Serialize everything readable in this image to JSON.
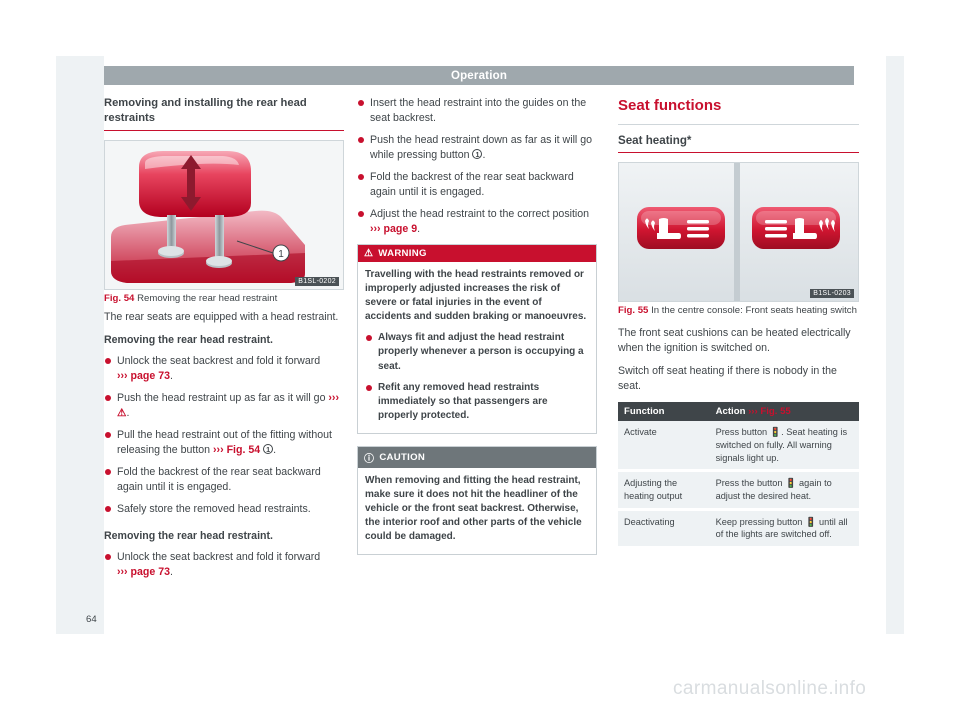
{
  "header": {
    "title": "Operation"
  },
  "page_number": "64",
  "watermark": "carmanualsonline.info",
  "col1": {
    "heading": "Removing and installing the rear head restraints",
    "figure": {
      "label": "Fig. 54",
      "caption": "Removing the rear head restraint",
      "image_code": "B1SL-0202",
      "callout": "1"
    },
    "intro": "The rear seats are equipped with a head restraint.",
    "sub1": "Removing the rear head restraint.",
    "bullets1": [
      "Unlock the seat backrest and fold it forward ››› page 73.",
      "Push the head restraint up as far as it will go ››› .",
      "Pull the head restraint out of the fitting without releasing the button ››› Fig. 54 1 .",
      "Fold the backrest of the rear seat backward again until it is engaged.",
      "Safely store the removed head restraints."
    ],
    "sub2": "Removing the rear head restraint.",
    "bullets2": [
      "Unlock the seat backrest and fold it forward ››› page 73."
    ]
  },
  "col2": {
    "bullets": [
      "Insert the head restraint into the guides on the seat backrest.",
      "Push the head restraint down as far as it will go while pressing button 1 .",
      "Fold the backrest of the rear seat backward again until it is engaged.",
      "Adjust the head restraint to the correct position ››› page 9."
    ],
    "warning": {
      "title": "WARNING",
      "intro": "Travelling with the head restraints removed or improperly adjusted increases the risk of severe or fatal injuries in the event of accidents and sudden braking or manoeuvres.",
      "bullets": [
        "Always fit and adjust the head restraint properly whenever a person is occupying a seat.",
        "Refit any removed head restraints immediately so that passengers are properly protected."
      ]
    },
    "caution": {
      "title": "CAUTION",
      "intro": "When removing and fitting the head restraint, make sure it does not hit the headliner of the vehicle or the front seat backrest. Otherwise, the interior roof and other parts of the vehicle could be damaged."
    }
  },
  "col3": {
    "heading": "Seat functions",
    "subheading": "Seat heating*",
    "figure": {
      "label": "Fig. 55",
      "caption": "In the centre console: Front seats heating switch",
      "image_code": "B1SL-0203"
    },
    "paragraphs": [
      "The front seat cushions can be heated electrically when the ignition is switched on.",
      "Switch off seat heating if there is nobody in the seat."
    ],
    "table": {
      "columns": [
        "Function",
        "Action ››› Fig. 55"
      ],
      "column2_ref": "Fig. 55",
      "rows": [
        {
          "function": "Activate",
          "action": "Press button  . Seat heating is switched on fully. All warning signals light up."
        },
        {
          "function": "Adjusting the heating output",
          "action": "Press the button  again to adjust the desired heat."
        },
        {
          "function": "Deactivating",
          "action": "Keep pressing button  until all of the lights are switched off."
        }
      ]
    }
  },
  "colors": {
    "accent": "#c8102e",
    "header_bar": "#9fa8ad",
    "dark": "#3f4549",
    "panel": "#eef2f4"
  }
}
